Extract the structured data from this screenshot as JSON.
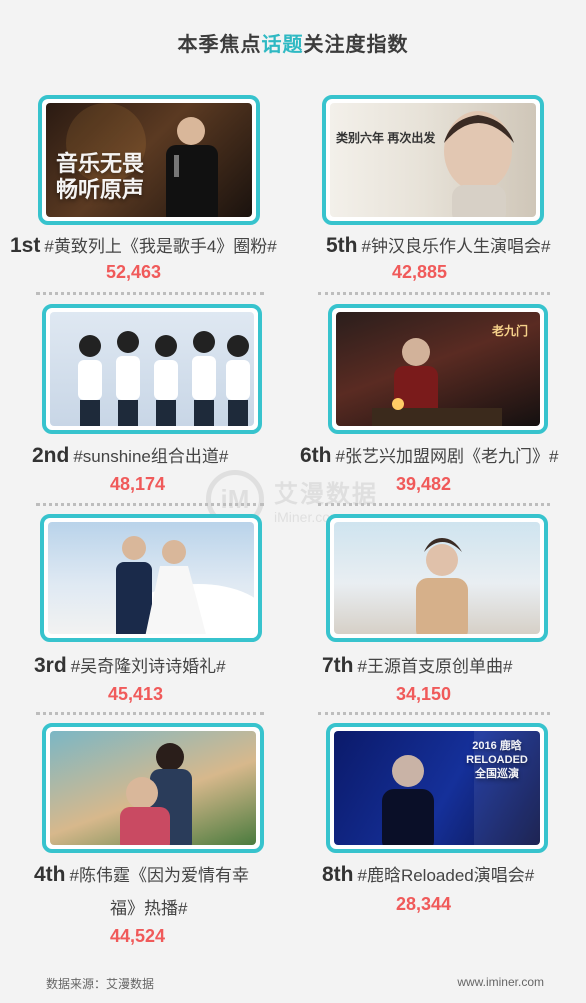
{
  "header": {
    "title_prefix": "本季焦点",
    "title_highlight": "话题",
    "title_suffix": "关注度指数"
  },
  "items": [
    {
      "rank": "1st",
      "topic": "#黄致列上《我是歌手4》圈粉#",
      "value": "52,463",
      "overlay": "音乐无畏\n畅听原声"
    },
    {
      "rank": "2nd",
      "topic": "#sunshine组合出道#",
      "value": "48,174"
    },
    {
      "rank": "3rd",
      "topic": "#吴奇隆刘诗诗婚礼#",
      "value": "45,413"
    },
    {
      "rank": "4th",
      "topic": "#陈伟霆《因为爱情有幸",
      "topic_line2": "福》热播#",
      "value": "44,524"
    },
    {
      "rank": "5th",
      "topic": "#钟汉良乐作人生演唱会#",
      "value": "42,885",
      "overlay": "类别六年  再次出发"
    },
    {
      "rank": "6th",
      "topic": "#张艺兴加盟网剧《老九门》#",
      "value": "39,482",
      "overlay": "老九门"
    },
    {
      "rank": "7th",
      "topic": "#王源首支原创单曲#",
      "value": "34,150"
    },
    {
      "rank": "8th",
      "topic": "#鹿晗Reloaded演唱会#",
      "value": "28,344",
      "overlay": "2016 鹿晗 RELOADED 全国巡演"
    }
  ],
  "watermark": {
    "logo": "iM",
    "name": "艾漫数据",
    "domain": "iMiner.com"
  },
  "footer": {
    "source": "数据来源：艾漫数据",
    "site": "www.iminer.com"
  },
  "colors": {
    "accent": "#37c3cd",
    "value": "#f05a5a",
    "background": "#f3f3f3"
  }
}
